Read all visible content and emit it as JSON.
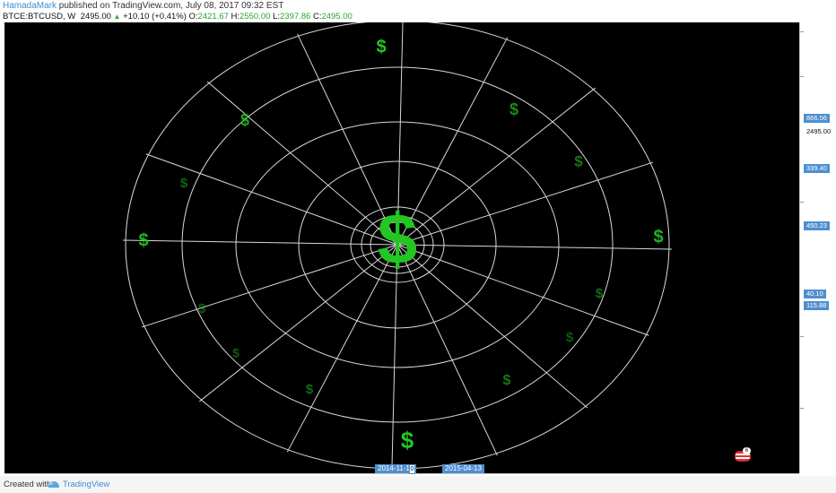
{
  "header": {
    "author": "HamadaMark",
    "published_text": " published on TradingView.com, July 08, 2017 09:32 EST",
    "symbol": "BTCE:BTCUSD, W",
    "price": "2495.00",
    "change": "+10.10 (+0.41%)",
    "open_label": "O:",
    "open": "2421.67",
    "high_label": "H:",
    "high": "2550.00",
    "low_label": "L:",
    "low": "2397.86",
    "close_label": "C:",
    "close": "2495.00"
  },
  "y_axis": {
    "labels": [
      {
        "text": "866.56",
        "highlight": true
      },
      {
        "text": "2495.00",
        "highlight": false
      },
      {
        "text": "339.40",
        "highlight": true
      },
      {
        "text": "450.23",
        "highlight": true
      },
      {
        "text": "40.10",
        "highlight": true
      },
      {
        "text": "115.88",
        "highlight": true
      }
    ]
  },
  "x_axis": {
    "labels": [
      "2014-11-10",
      "2015-04-13"
    ],
    "stub_label": "0"
  },
  "drawing": {
    "dollar_symbol": "$",
    "dollar_color": "#22c722",
    "line_color": "#d9d9d9",
    "background": "#000000",
    "ring_count": 6,
    "spoke_count": 16
  },
  "footer": {
    "created_with": "Created with",
    "brand": "TradingView"
  },
  "flag_badge": "6"
}
